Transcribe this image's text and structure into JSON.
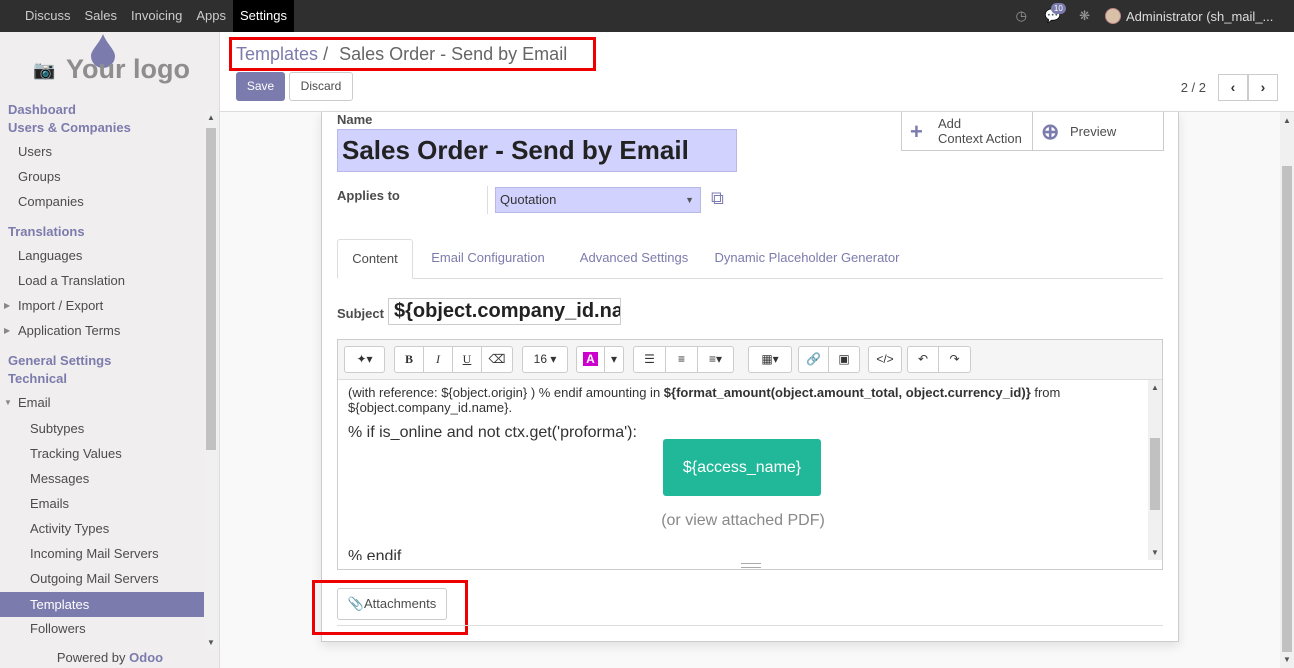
{
  "topbar": {
    "menu": [
      "Discuss",
      "Sales",
      "Invoicing",
      "Apps",
      "Settings"
    ],
    "active_menu": "Settings",
    "message_count": "10",
    "user": "Administrator (sh_mail_..."
  },
  "logo": {
    "text": "Your logo"
  },
  "sidebar": {
    "items": [
      {
        "label": "Dashboard",
        "type": "header"
      },
      {
        "label": "Users & Companies",
        "type": "header"
      },
      {
        "label": "Users",
        "type": "l1"
      },
      {
        "label": "Groups",
        "type": "l1"
      },
      {
        "label": "Companies",
        "type": "l1"
      },
      {
        "label": "Translations",
        "type": "header"
      },
      {
        "label": "Languages",
        "type": "l1"
      },
      {
        "label": "Load a Translation",
        "type": "l1"
      },
      {
        "label": "Import / Export",
        "type": "l1"
      },
      {
        "label": "Application Terms",
        "type": "l1"
      },
      {
        "label": "General Settings",
        "type": "header"
      },
      {
        "label": "Technical",
        "type": "header"
      },
      {
        "label": "Email",
        "type": "l1"
      },
      {
        "label": "Subtypes",
        "type": "l2"
      },
      {
        "label": "Tracking Values",
        "type": "l2"
      },
      {
        "label": "Messages",
        "type": "l2"
      },
      {
        "label": "Emails",
        "type": "l2"
      },
      {
        "label": "Activity Types",
        "type": "l2"
      },
      {
        "label": "Incoming Mail Servers",
        "type": "l2"
      },
      {
        "label": "Outgoing Mail Servers",
        "type": "l2"
      },
      {
        "label": "Templates",
        "type": "l2"
      },
      {
        "label": "Followers",
        "type": "l2"
      }
    ],
    "powered_prefix": "Powered by",
    "powered_brand": "Odoo"
  },
  "control": {
    "breadcrumb_parent": "Templates",
    "breadcrumb_sep": "/",
    "breadcrumb_current": "Sales Order - Send by Email",
    "save_label": "Save",
    "discard_label": "Discard",
    "pager": "2 / 2"
  },
  "form": {
    "name_label": "Name",
    "name_value": "Sales Order - Send by Email",
    "smart_add_line1": "Add",
    "smart_add_line2": "Context Action",
    "smart_preview": "Preview",
    "applies_label": "Applies to",
    "applies_value": "Quotation",
    "tabs": [
      "Content",
      "Email Configuration",
      "Advanced Settings",
      "Dynamic Placeholder Generator"
    ],
    "active_tab": "Content",
    "subject_label": "Subject",
    "subject_value": "${object.company_id.name}",
    "editor": {
      "font_size": "16",
      "line1_a": "(with reference: ${object.origin} ) % endif amounting in ",
      "line1_b": "${format_amount(object.amount_total, object.currency_id)}",
      "line1_c": " from",
      "line2": "${object.company_id.name}.",
      "if_line": "% if is_online and not ctx.get('proforma'):",
      "access_button": "${access_name}",
      "view_pdf": "(or view attached PDF)",
      "endif_line": "% endif"
    },
    "attachments_label": "Attachments"
  },
  "colors": {
    "brand": "#7c7bad",
    "access_button": "#21b799",
    "highlight_box": "#ee0000"
  }
}
